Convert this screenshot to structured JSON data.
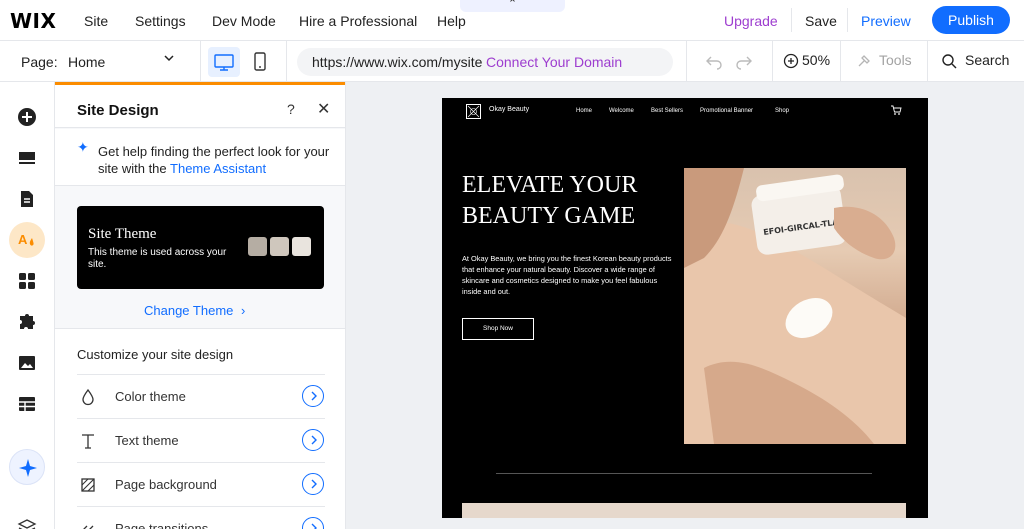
{
  "topbar": {
    "logo": "WIX",
    "nav": [
      "Site",
      "Settings",
      "Dev Mode",
      "Hire a Professional",
      "Help"
    ],
    "pull_tab": "⌃",
    "upgrade": "Upgrade",
    "save": "Save",
    "preview": "Preview",
    "publish": "Publish"
  },
  "toolbar": {
    "page_label": "Page:",
    "page_value": "Home",
    "url": "https://www.wix.com/mysite",
    "connect_domain": "Connect Your Domain",
    "zoom": "50%",
    "tools": "Tools",
    "search": "Search"
  },
  "panel": {
    "title": "Site Design",
    "help": "?",
    "close": "✕",
    "assistant_text": "Get help finding the perfect look for your site with the ",
    "assistant_link": "Theme Assistant",
    "theme_card_title": "Site Theme",
    "theme_card_subtitle": "This theme is used across your site.",
    "swatches": [
      "#b5ada3",
      "#cfc7bd",
      "#e9e4de"
    ],
    "change_theme": "Change Theme",
    "customize_title": "Customize your site design",
    "items": [
      {
        "label": "Color theme"
      },
      {
        "label": "Text theme"
      },
      {
        "label": "Page background"
      },
      {
        "label": "Page transitions"
      }
    ]
  },
  "site": {
    "name": "Okay Beauty",
    "nav": [
      "Home",
      "Welcome",
      "Best Sellers",
      "Promotional Banner",
      "Shop"
    ],
    "hero_title": "ELEVATE YOUR BEAUTY GAME",
    "hero_body": "At Okay Beauty, we bring you the finest Korean beauty products that enhance your natural beauty. Discover a wide range of skincare and cosmetics designed to make you feel fabulous inside and out.",
    "cta": "Shop Now",
    "jar_label": "EFOI-GIRCAL-TLA"
  },
  "colors": {
    "accent_blue": "#116dff",
    "upgrade_purple": "#9d3dcf",
    "panel_accent": "#fb8c00"
  }
}
